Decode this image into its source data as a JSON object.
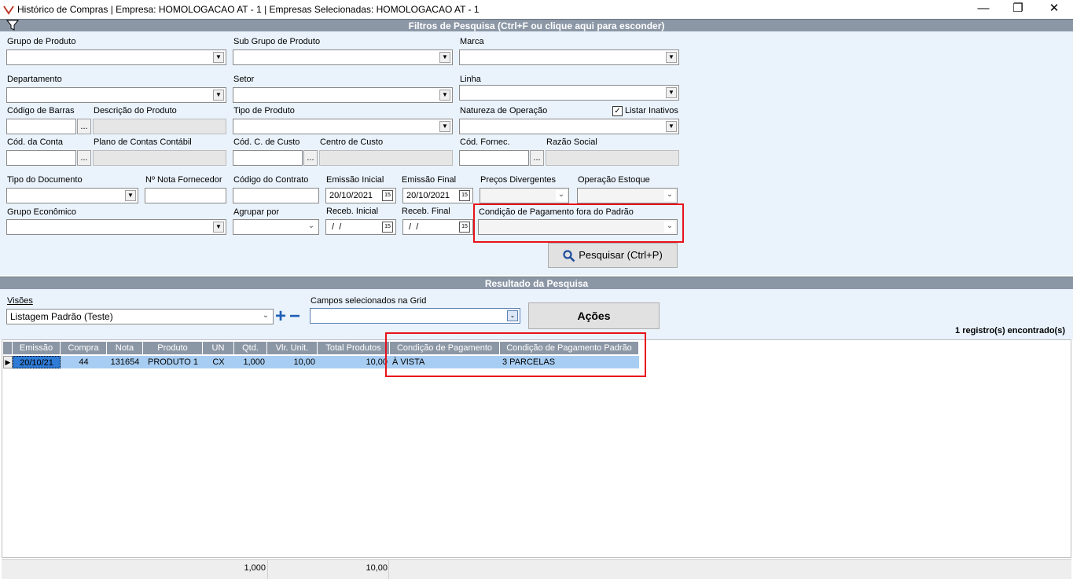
{
  "window": {
    "title": "Histórico de Compras | Empresa: HOMOLOGACAO AT - 1 | Empresas Selecionadas: HOMOLOGACAO AT - 1",
    "minimize": "—",
    "maximize": "❐",
    "close": "✕"
  },
  "filters": {
    "header": "Filtros de Pesquisa (Ctrl+F ou clique aqui para esconder)",
    "labels": {
      "grupo_produto": "Grupo de Produto",
      "sub_grupo": "Sub Grupo de Produto",
      "marca": "Marca",
      "departamento": "Departamento",
      "setor": "Setor",
      "linha": "Linha",
      "codigo_barras": "Código de Barras",
      "descricao_produto": "Descrição do Produto",
      "tipo_produto": "Tipo de Produto",
      "natureza_operacao": "Natureza de Operação",
      "listar_inativos": "Listar Inativos",
      "cod_conta": "Cód. da Conta",
      "plano_contas": "Plano de Contas Contábil",
      "cod_c_custo": "Cód. C. de Custo",
      "centro_custo": "Centro de Custo",
      "cod_fornec": "Cód. Fornec.",
      "razao_social": "Razão Social",
      "tipo_documento": "Tipo do Documento",
      "nota_fornecedor": "Nº Nota Fornecedor",
      "codigo_contrato": "Código do Contrato",
      "emissao_inicial": "Emissão Inicial",
      "emissao_final": "Emissão Final",
      "precos_divergentes": "Preços Divergentes",
      "operacao_estoque": "Operação Estoque",
      "grupo_economico": "Grupo Econômico",
      "agrupar_por": "Agrupar por",
      "receb_inicial": "Receb. Inicial",
      "receb_final": "Receb. Final",
      "condicao_fora_padrao": "Condição de Pagamento fora do Padrão"
    },
    "values": {
      "emissao_inicial": "20/10/2021",
      "emissao_final": "20/10/2021",
      "receb_inicial": " /  /",
      "receb_final": " /  /"
    },
    "dots_label": "...",
    "calendar_label": "15",
    "listar_inativos_checked": true,
    "search_button": "Pesquisar (Ctrl+P)"
  },
  "results": {
    "header": "Resultado da Pesquisa",
    "visoes_label": "Visões",
    "visoes_value": "Listagem Padrão (Teste)",
    "campos_label": "Campos selecionados na Grid",
    "acoes_button": "Ações",
    "count_text": "1 registro(s) encontrado(s)",
    "plus": "+",
    "minus": "−",
    "columns": [
      "Emissão",
      "Compra",
      "Nota",
      "Produto",
      "UN",
      "Qtd.",
      "Vlr. Unit.",
      "Total Produtos",
      "Condição de Pagamento",
      "Condição de Pagamento Padrão"
    ],
    "rows": [
      [
        "20/10/21",
        "44",
        "131654",
        "PRODUTO 1",
        "CX",
        "1,000",
        "10,00",
        "10,00",
        "À VISTA",
        "3 PARCELAS"
      ]
    ],
    "totals": {
      "qtd": "1,000",
      "total": "10,00"
    }
  },
  "colors": {
    "band": "#8c97a6",
    "panel": "#eaf3fc",
    "highlight": "#e8121c",
    "row_selected": "#a8cdf2"
  }
}
